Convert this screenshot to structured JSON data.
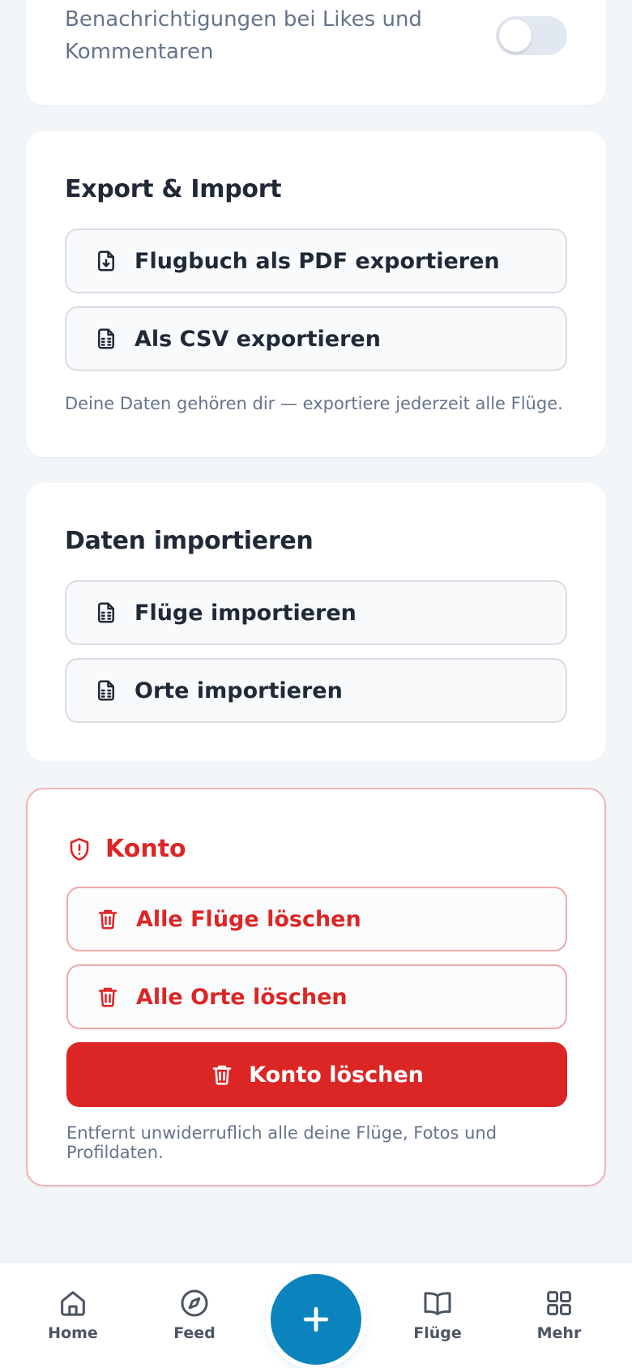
{
  "notifications": {
    "label": "Benachrichtigungen bei Likes und Kommentaren",
    "enabled": false
  },
  "export": {
    "title": "Export & Import",
    "buttons": [
      {
        "label": "Flugbuch als PDF exportieren",
        "icon": "file-download-icon"
      },
      {
        "label": "Als CSV exportieren",
        "icon": "file-spreadsheet-icon"
      }
    ],
    "hint": "Deine Daten gehören dir — exportiere jederzeit alle Flüge."
  },
  "import": {
    "title": "Daten importieren",
    "buttons": [
      {
        "label": "Flüge importieren",
        "icon": "file-spreadsheet-icon"
      },
      {
        "label": "Orte importieren",
        "icon": "file-spreadsheet-icon"
      }
    ]
  },
  "account": {
    "title": "Konto",
    "title_icon": "shield-alert-icon",
    "buttons": [
      {
        "label": "Alle Flüge löschen",
        "icon": "trash-icon"
      },
      {
        "label": "Alle Orte löschen",
        "icon": "trash-icon"
      }
    ],
    "delete_account_label": "Konto löschen",
    "hint": "Entfernt unwiderruflich alle deine Flüge, Fotos und Profildaten.",
    "danger_color": "#dc2626"
  },
  "nav": {
    "items": [
      {
        "label": "Home",
        "icon": "home-icon"
      },
      {
        "label": "Feed",
        "icon": "compass-icon"
      },
      {
        "label": "Flüge",
        "icon": "book-icon"
      },
      {
        "label": "Mehr",
        "icon": "grid-icon"
      }
    ],
    "fab_icon": "plus-icon",
    "accent_color": "#0b84bd"
  }
}
